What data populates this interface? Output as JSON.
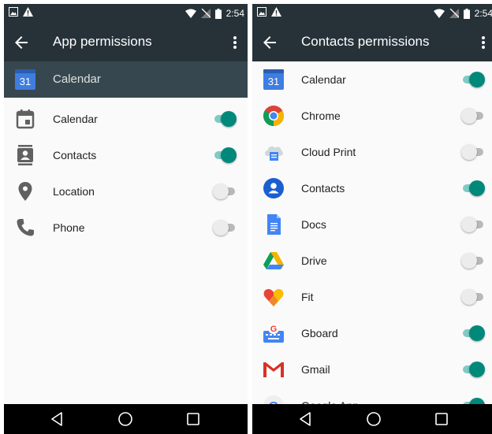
{
  "left": {
    "status": {
      "time": "2:54"
    },
    "appbar": {
      "title": "App permissions"
    },
    "app": {
      "name": "Calendar",
      "icon_text": "31"
    },
    "permissions": [
      {
        "label": "Calendar",
        "icon": "calendar-icon",
        "enabled": true
      },
      {
        "label": "Contacts",
        "icon": "contacts-icon",
        "enabled": true
      },
      {
        "label": "Location",
        "icon": "location-icon",
        "enabled": false
      },
      {
        "label": "Phone",
        "icon": "phone-icon",
        "enabled": false
      }
    ]
  },
  "right": {
    "status": {
      "time": "2:54"
    },
    "appbar": {
      "title": "Contacts permissions"
    },
    "apps": [
      {
        "label": "Calendar",
        "icon": "calendar-app-icon",
        "icon_text": "31",
        "enabled": true
      },
      {
        "label": "Chrome",
        "icon": "chrome-icon",
        "enabled": false
      },
      {
        "label": "Cloud Print",
        "icon": "cloud-print-icon",
        "enabled": false
      },
      {
        "label": "Contacts",
        "icon": "contacts-app-icon",
        "enabled": true
      },
      {
        "label": "Docs",
        "icon": "docs-icon",
        "enabled": false
      },
      {
        "label": "Drive",
        "icon": "drive-icon",
        "enabled": false
      },
      {
        "label": "Fit",
        "icon": "fit-icon",
        "enabled": false
      },
      {
        "label": "Gboard",
        "icon": "gboard-icon",
        "icon_text": "G",
        "enabled": true
      },
      {
        "label": "Gmail",
        "icon": "gmail-icon",
        "enabled": true
      },
      {
        "label": "Google App",
        "icon": "google-app-icon",
        "icon_text": "G",
        "enabled": true
      }
    ]
  },
  "colors": {
    "bar": "#263238",
    "header": "#37474f",
    "accent": "#00897b",
    "accent_track": "#80cbc4"
  }
}
